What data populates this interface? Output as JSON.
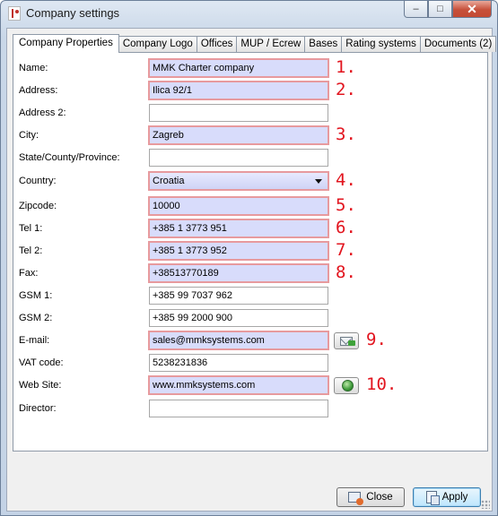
{
  "window": {
    "title": "Company settings",
    "minimize": "–",
    "maximize": "□",
    "close": "✕"
  },
  "tabs": [
    {
      "label": "Company Properties",
      "active": true
    },
    {
      "label": "Company Logo"
    },
    {
      "label": "Offices"
    },
    {
      "label": "MUP / Ecrew"
    },
    {
      "label": "Bases"
    },
    {
      "label": "Rating systems"
    },
    {
      "label": "Documents (2)"
    }
  ],
  "form": {
    "name": {
      "label": "Name:",
      "value": "MMK Charter company",
      "marker": "1."
    },
    "address": {
      "label": "Address:",
      "value": "Ilica 92/1",
      "marker": "2."
    },
    "address2": {
      "label": "Address 2:",
      "value": ""
    },
    "city": {
      "label": "City:",
      "value": "Zagreb",
      "marker": "3."
    },
    "state": {
      "label": "State/County/Province:",
      "value": ""
    },
    "country": {
      "label": "Country:",
      "value": "Croatia",
      "marker": "4."
    },
    "zipcode": {
      "label": "Zipcode:",
      "value": "10000",
      "marker": "5."
    },
    "tel1": {
      "label": "Tel 1:",
      "value": "+385 1 3773 951",
      "marker": "6."
    },
    "tel2": {
      "label": "Tel 2:",
      "value": "+385 1 3773 952",
      "marker": "7."
    },
    "fax": {
      "label": "Fax:",
      "value": "+38513770189",
      "marker": "8."
    },
    "gsm1": {
      "label": "GSM 1:",
      "value": "+385 99 7037 962"
    },
    "gsm2": {
      "label": "GSM 2:",
      "value": "+385 99 2000 900"
    },
    "email": {
      "label": "E-mail:",
      "value": "sales@mmksystems.com",
      "marker": "9."
    },
    "vat": {
      "label": "VAT code:",
      "value": "5238231836"
    },
    "website": {
      "label": "Web Site:",
      "value": "www.mmksystems.com",
      "marker": "10."
    },
    "director": {
      "label": "Director:",
      "value": ""
    }
  },
  "buttons": {
    "close": "Close",
    "apply": "Apply"
  },
  "colors": {
    "highlight_fill": "#d8dcfb",
    "highlight_border": "#e79a9e",
    "marker": "#e2141e"
  }
}
